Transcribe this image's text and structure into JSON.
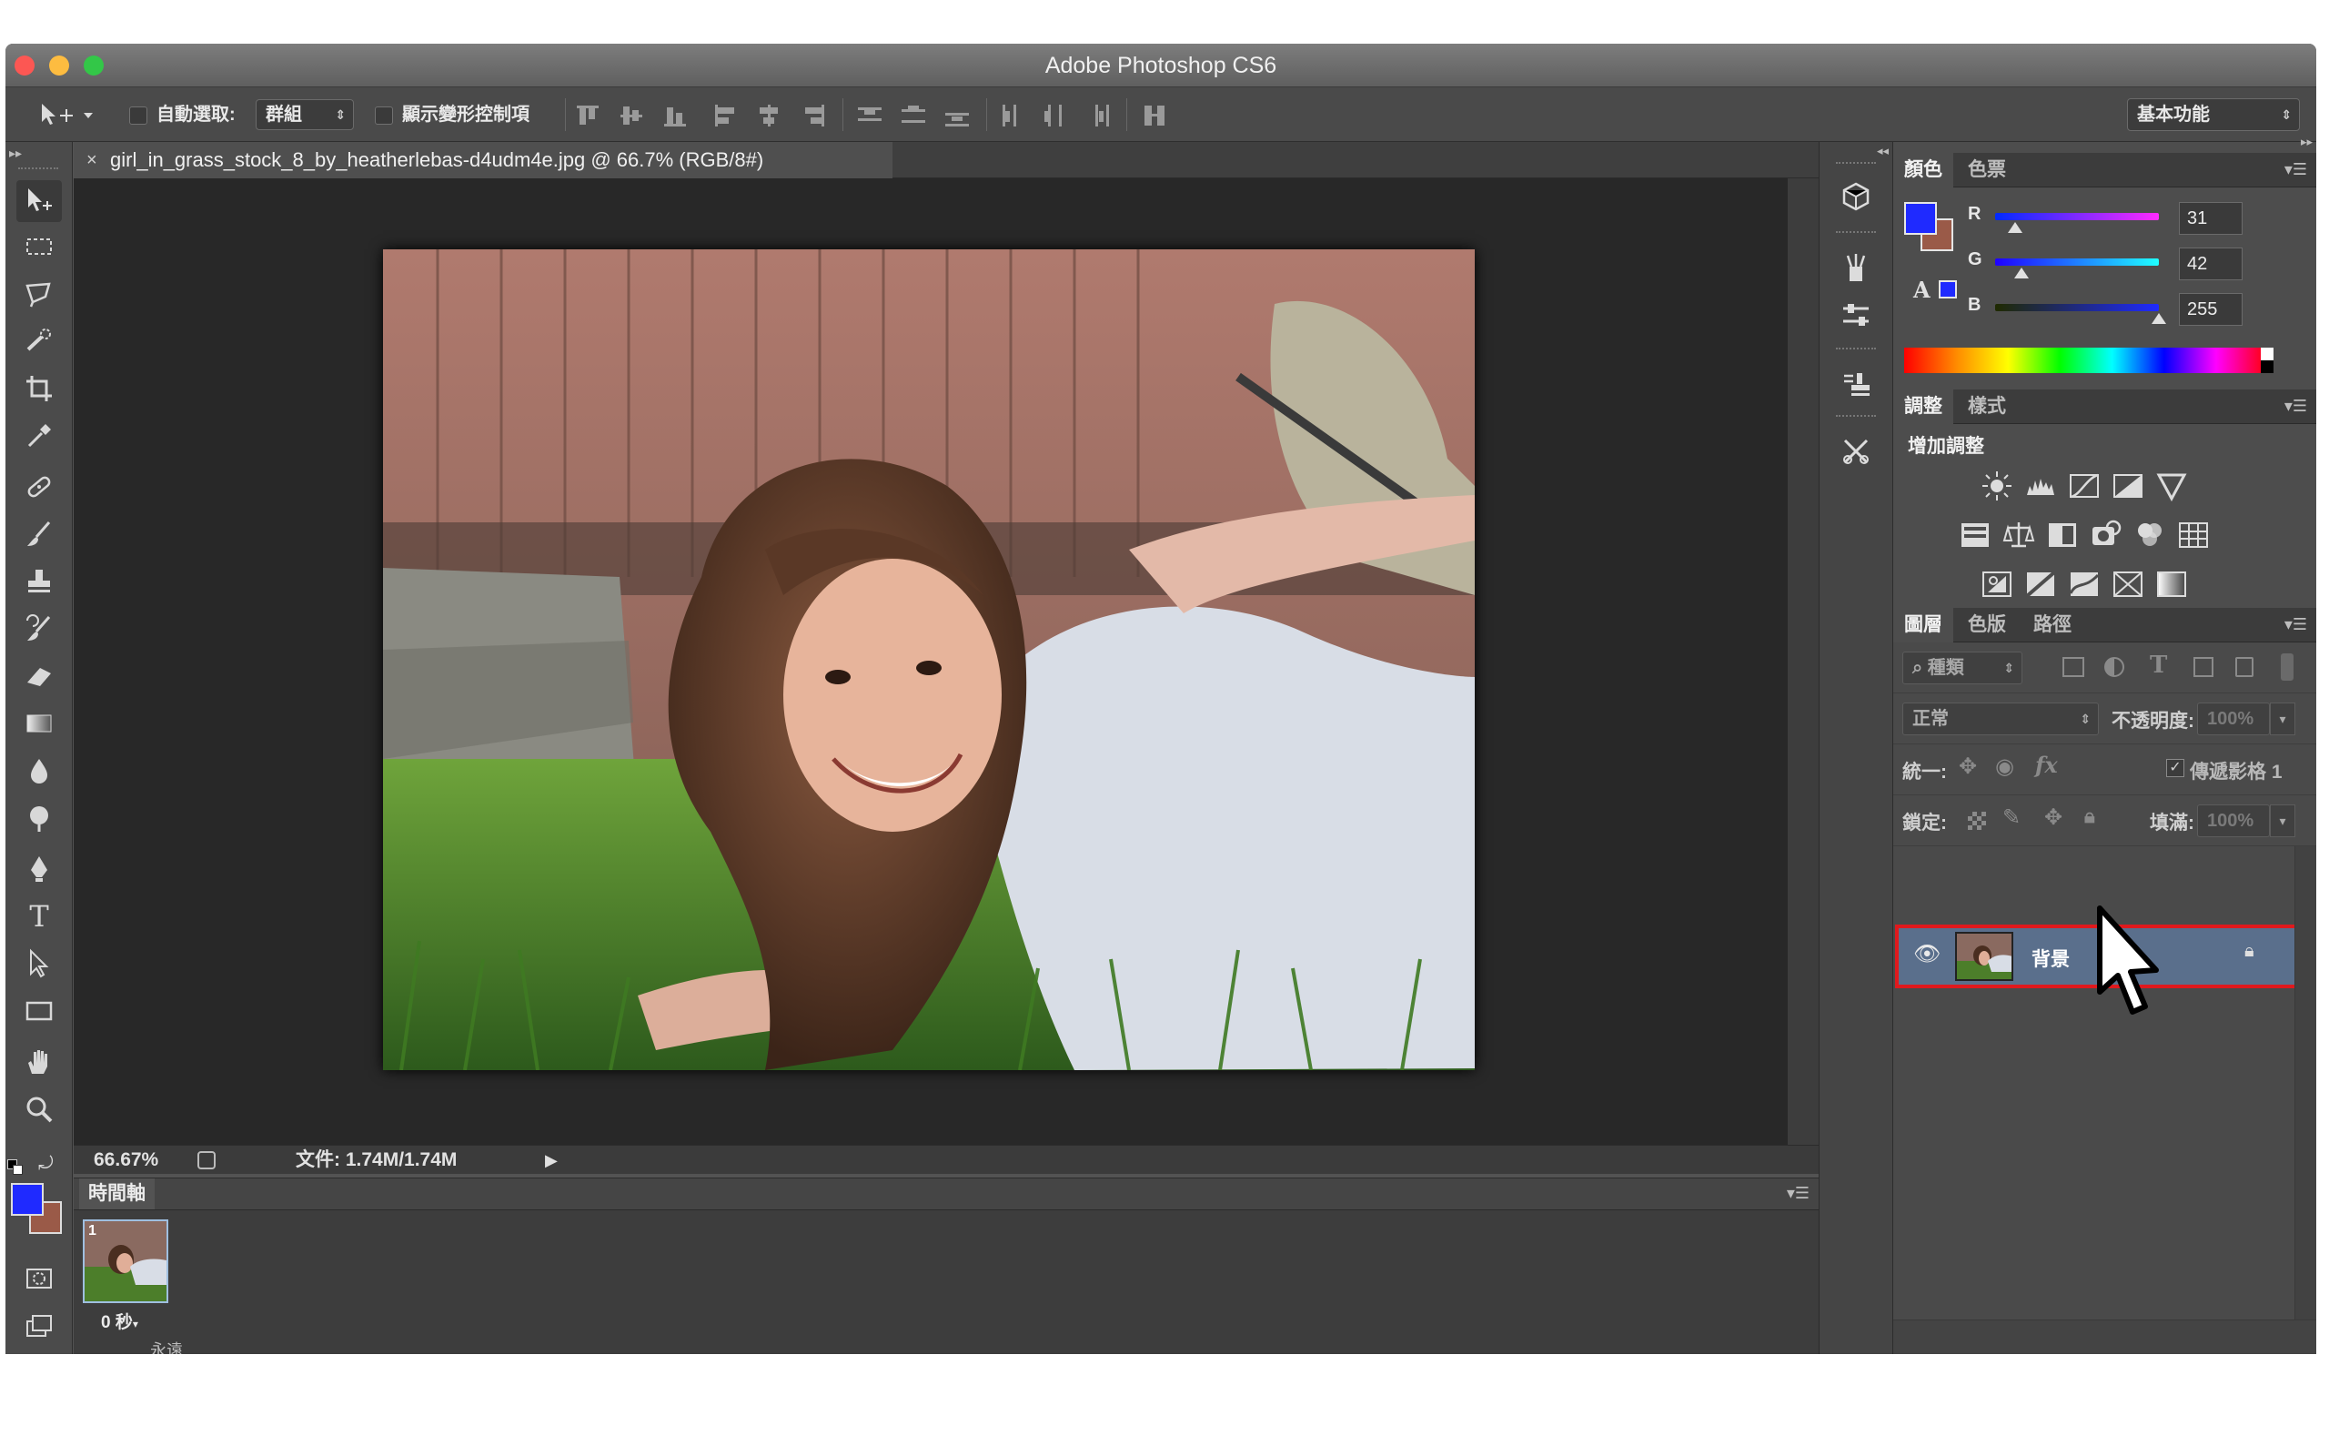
{
  "app": {
    "title": "Adobe Photoshop CS6"
  },
  "options_bar": {
    "auto_select_label": "自動選取:",
    "auto_select_value": "群組",
    "show_transform_label": "顯示變形控制項",
    "workspace_value": "基本功能"
  },
  "document": {
    "tab_label": "girl_in_grass_stock_8_by_heatherlebas-d4udm4e.jpg @ 66.7% (RGB/8#)"
  },
  "status_bar": {
    "zoom": "66.67%",
    "file_info": "文件: 1.74M/1.74M"
  },
  "timeline": {
    "tab_label": "時間軸",
    "frame_number": "1",
    "frame_delay": "0 秒",
    "loop_label": "永遠"
  },
  "color_panel": {
    "tabs": [
      "顏色",
      "色票"
    ],
    "channels": [
      {
        "label": "R",
        "value": "31",
        "fraction": 0.12
      },
      {
        "label": "G",
        "value": "42",
        "fraction": 0.16
      },
      {
        "label": "B",
        "value": "255",
        "fraction": 1.0
      }
    ],
    "foreground": "#1f2aff",
    "background": "#9a5a48"
  },
  "adjustments_panel": {
    "tabs": [
      "調整",
      "樣式"
    ],
    "heading": "增加調整"
  },
  "layers_panel": {
    "tabs": [
      "圖層",
      "色版",
      "路徑"
    ],
    "filter_kind": "種類",
    "blend_mode": "正常",
    "opacity_label": "不透明度:",
    "opacity_value": "100%",
    "unify_label": "統一:",
    "propagate_label": "傳遞影格 1",
    "lock_label": "鎖定:",
    "fill_label": "填滿:",
    "fill_value": "100%",
    "layers": [
      {
        "name": "背景",
        "visible": true,
        "locked": true,
        "selected": true
      }
    ]
  },
  "toolbar": {
    "foreground": "#1f2aff",
    "background": "#9a5a48"
  }
}
